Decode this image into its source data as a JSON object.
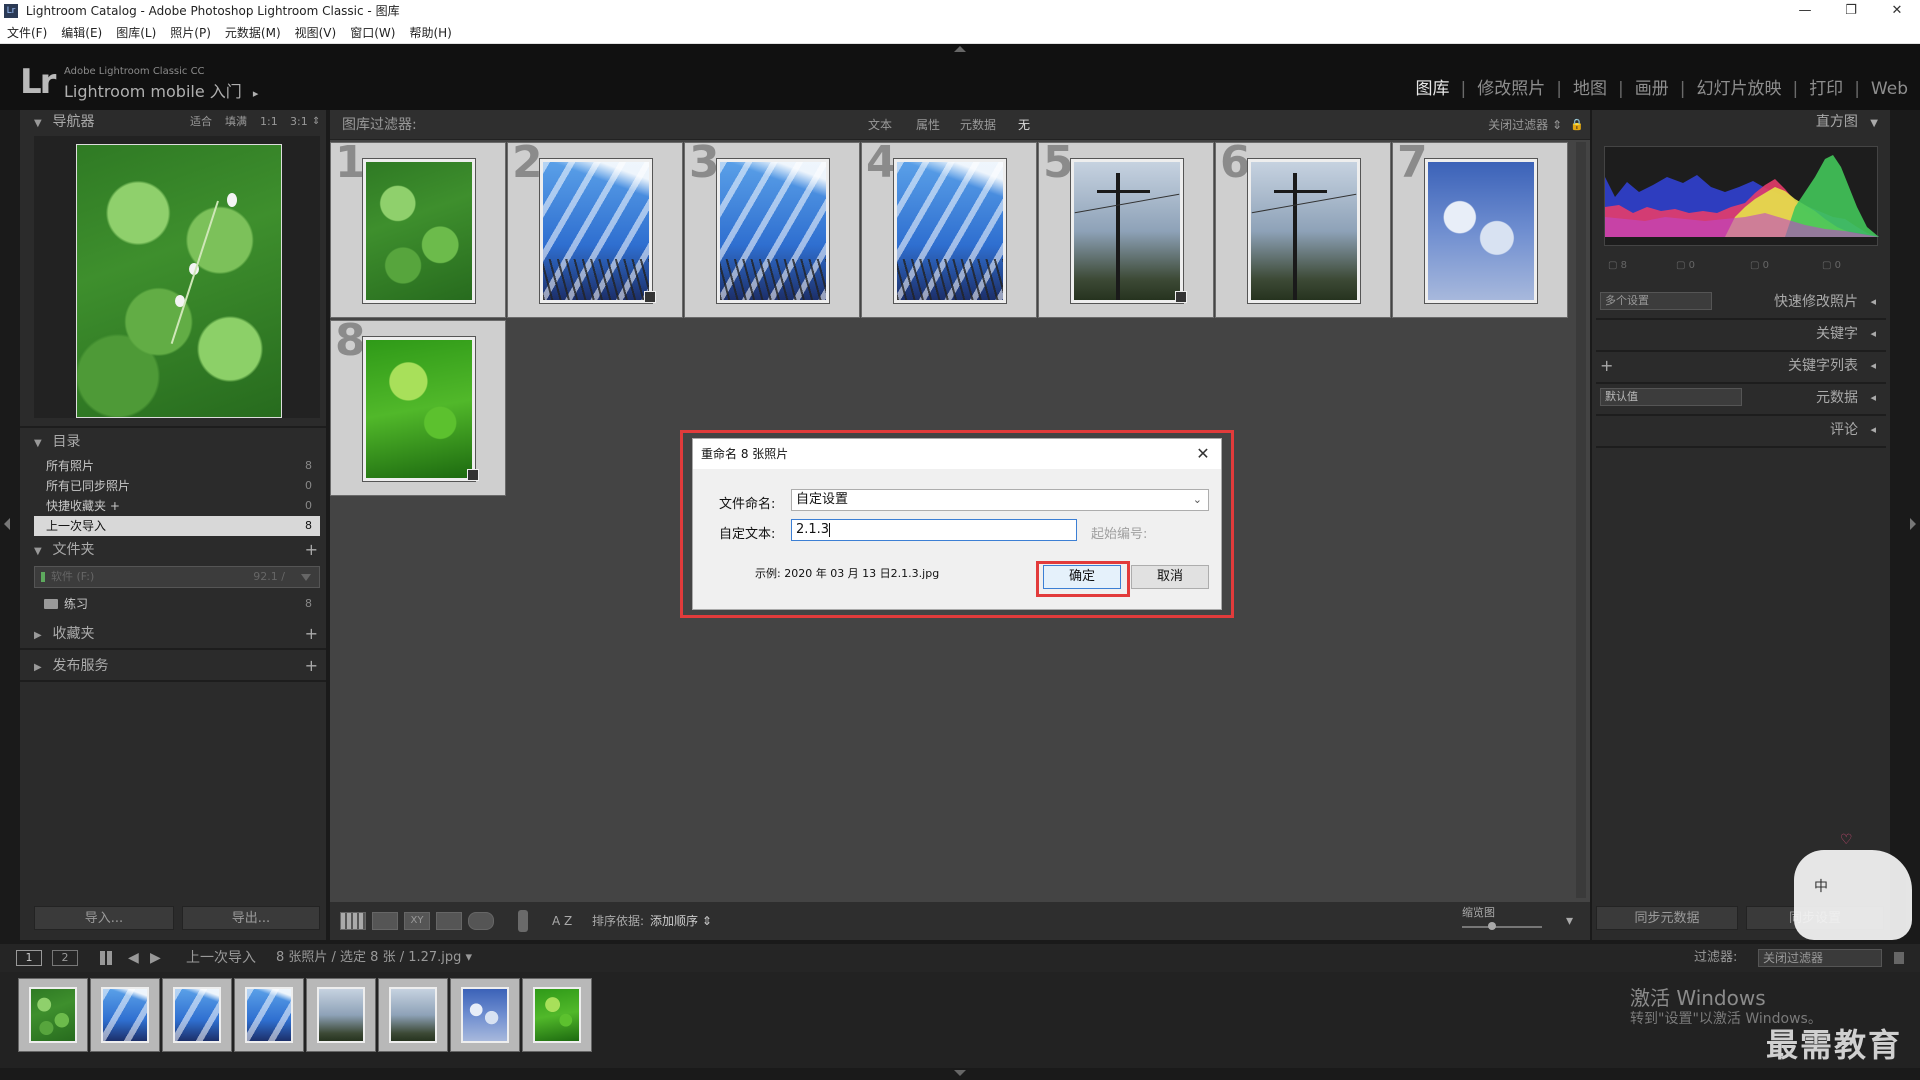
{
  "window": {
    "title": "Lightroom Catalog - Adobe Photoshop Lightroom Classic - 图库",
    "minimize": "—",
    "restore": "❐",
    "close": "✕"
  },
  "menu": [
    "文件(F)",
    "编辑(E)",
    "图库(L)",
    "照片(P)",
    "元数据(M)",
    "视图(V)",
    "窗口(W)",
    "帮助(H)"
  ],
  "identity": {
    "logo": "Lr",
    "product": "Adobe Lightroom Classic CC",
    "mobile": "Lightroom mobile 入门",
    "arrow": "▸"
  },
  "modules": [
    "图库",
    "修改照片",
    "地图",
    "画册",
    "幻灯片放映",
    "打印",
    "Web"
  ],
  "module_sep": "|",
  "navigator": {
    "title": "导航器",
    "zoom_options": [
      "适合",
      "填满",
      "1:1",
      "3:1"
    ],
    "zoom_arrow": "⇕"
  },
  "catalog": {
    "title": "目录",
    "items": [
      {
        "label": "所有照片",
        "count": "8"
      },
      {
        "label": "所有已同步照片",
        "count": "0"
      },
      {
        "label": "快捷收藏夹 +",
        "count": "0"
      },
      {
        "label": "上一次导入",
        "count": "8"
      }
    ]
  },
  "folders": {
    "title": "文件夹",
    "plus": "+",
    "volume": {
      "name": "软件 (F:)",
      "space": "92.1 /"
    },
    "items": [
      {
        "label": "练习",
        "count": "8"
      }
    ]
  },
  "collections": {
    "title": "收藏夹",
    "plus": "+"
  },
  "publish": {
    "title": "发布服务",
    "plus": "+"
  },
  "left_buttons": {
    "import": "导入...",
    "export": "导出..."
  },
  "filter_bar": {
    "label": "图库过滤器:",
    "options": [
      "文本",
      "属性",
      "元数据",
      "无"
    ],
    "close": "关闭过滤器 ⇕",
    "lock": "🔒"
  },
  "grid": {
    "cells": [
      {
        "num": "1",
        "theme": "clover"
      },
      {
        "num": "2",
        "theme": "sky"
      },
      {
        "num": "3",
        "theme": "sky"
      },
      {
        "num": "4",
        "theme": "sky"
      },
      {
        "num": "5",
        "theme": "pole"
      },
      {
        "num": "6",
        "theme": "pole"
      },
      {
        "num": "7",
        "theme": "cloud"
      },
      {
        "num": "8",
        "theme": "leaves"
      }
    ]
  },
  "toolbar": {
    "sort_label": "排序依据:",
    "sort_value": "添加顺序 ⇕",
    "az": "A Z",
    "zoom_label": "缩览图",
    "dropdown": "▾"
  },
  "right_panel": {
    "histogram": "直方图",
    "histo_stats": [
      "8",
      "0",
      "0",
      "0"
    ],
    "quick_dev_preset": "多个设置",
    "quick_dev": "快速修改照片",
    "keywording": "关键字",
    "keyword_list": "关键字列表",
    "meta_preset": "默认值",
    "metadata": "元数据",
    "comments": "评论",
    "sync_meta": "同步元数据",
    "sync_settings": "同步设置",
    "panel_tri": "◂",
    "plus": "+"
  },
  "filmstrip_bar": {
    "view1": "1",
    "view2": "2",
    "source": "上一次导入",
    "count": "8 张照片 / 选定 8 张 / 1.27.jpg ▾",
    "filter_label": "过滤器:",
    "filter_value": "关闭过滤器"
  },
  "dialog": {
    "title": "重命名 8 张照片",
    "close": "✕",
    "naming_label": "文件命名:",
    "naming_value": "自定设置",
    "custom_label": "自定文本:",
    "custom_value": "2.1.3",
    "start_label": "起始编号:",
    "example": "示例: 2020 年 03 月 13 日2.1.3.jpg",
    "ok": "确定",
    "cancel": "取消"
  },
  "watermarks": {
    "activate": "激活 Windows",
    "activate_sub": "转到\"设置\"以激活 Windows。",
    "brand": "最需教育",
    "ime": "中"
  },
  "colors": {
    "accent_red": "#e23b3b",
    "panel_bg": "#2b2b2b",
    "grid_bg": "#444444"
  }
}
